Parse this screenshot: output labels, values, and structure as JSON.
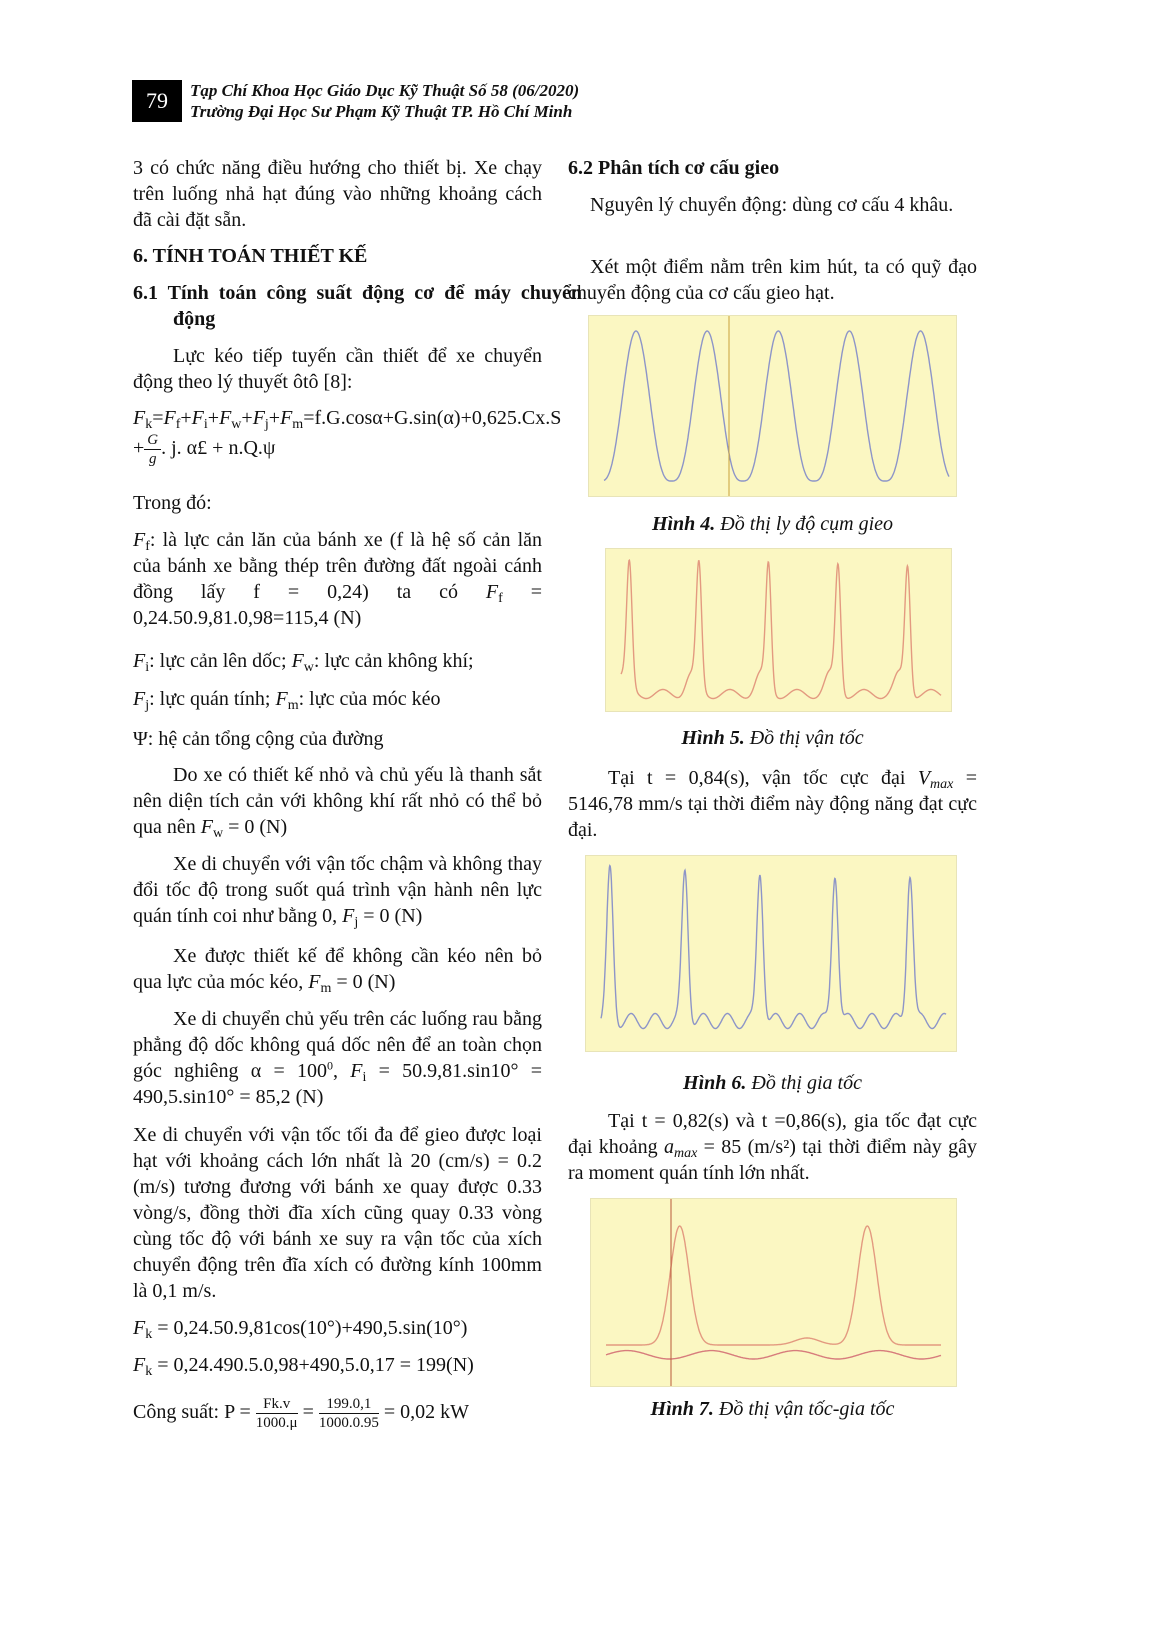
{
  "header": {
    "page_number": "79",
    "journal": "Tạp Chí Khoa Học Giáo Dục Kỹ Thuật Số 58 (06/2020)",
    "university": "Trường Đại Học Sư Phạm Kỹ Thuật TP. Hồ Chí Minh"
  },
  "left": {
    "p1": "3 có chức năng điều hướng cho thiết bị. Xe chạy trên luống nhả hạt đúng vào những khoảng cách đã cài đặt sẵn.",
    "h6": "6.   TÍNH TOÁN THIẾT KẾ",
    "h61": "6.1 Tính toán công suất động cơ để máy chuyển động",
    "p2": "Lực kéo tiếp tuyến cần thiết để xe chuyển động theo lý thuyết ôtô [8]:",
    "eq1_rhs": "=f.G.cosα+G.sin(α)+0,625.Cx.S +",
    "eq1_tail": ". j. α£  + n.Q.ψ",
    "trong_do": "Trong đó:",
    "ff_text": ": là lực cản lăn của bánh xe (f là hệ số cản lăn của bánh xe bằng thép trên đường đất ngoài cánh đồng lấy f = 0,24) ta có",
    "ff_value": "= 0,24.50.9,81.0,98=115,4 (N)",
    "fi_text": ": lực cản lên dốc;",
    "fw_text": ": lực cản không khí;",
    "fj_text": ": lực quán tính;",
    "fm_text": ": lực của móc kéo",
    "psi": "Ψ: hệ cản tổng cộng của đường",
    "p_fw": "Do xe có thiết kế nhỏ và chủ yếu là thanh sắt nên diện tích cản với không khí rất nhỏ có thể bỏ qua nên",
    "p_fw_val": "= 0 (N)",
    "p_fj": "Xe di chuyển với vận tốc chậm và không thay đổi tốc độ trong suốt quá trình vận hành nên lực quán tính coi như bằng 0,",
    "p_fj_val": "= 0 (N)",
    "p_fm": "Xe được thiết kế để không cần kéo nên bỏ qua lực của móc kéo,",
    "p_fm_val": "= 0 (N)",
    "p_fi": "Xe di chuyển chủ yếu trên các luống rau bằng phẳng độ dốc không quá dốc nên để an toàn chọn góc nghiêng α = 100",
    "p_fi_val": "= 50.9,81.sin10° = 490,5.sin10° = 85,2 (N)",
    "p_speed": "Xe di chuyển với vận tốc tối đa để gieo được loại hạt với khoảng cách lớn nhất là 20 (cm/s) = 0.2 (m/s) tương đương với bánh xe quay được 0.33 vòng/s, đồng thời đĩa xích cũng quay 0.33 vòng cùng tốc độ với bánh xe suy ra vận tốc của xích chuyển động trên đĩa xích có đường kính 100mm là 0,1 m/s.",
    "fk1": "= 0,24.50.9,81cos(10°)+490,5.sin(10°)",
    "fk2": "= 0,24.490.5.0,98+490,5.0,17 = 199(N)",
    "power_label": "Công suất: P =",
    "power_num1": "Fk.v",
    "power_den1": "1000.μ",
    "power_num2": "199.0,1",
    "power_den2": "1000.0.95",
    "power_result": "= 0,02 kW"
  },
  "right": {
    "h62": "6.2  Phân tích cơ cấu gieo",
    "p1": "Nguyên lý chuyển động: dùng cơ cấu 4 khâu.",
    "p2": "Xét một điểm nằm trên kim hút, ta có quỹ đạo chuyển động của cơ cấu gieo hạt.",
    "fig4_label": "Hình 4.",
    "fig4_title": "Đồ thị ly độ cụm gieo",
    "fig5_label": "Hình 5.",
    "fig5_title": "Đồ thị vận tốc",
    "p3a": "Tại t = 0,84(s), vận tốc cực đại",
    "p3b": "= 5146,78 mm/s tại thời điểm này động năng đạt cực đại.",
    "fig6_label": "Hình 6.",
    "fig6_title": "Đồ thị gia tốc",
    "p4a": "Tại t = 0,82(s) và t =0,86(s), gia tốc đạt cực đại khoảng",
    "p4b": "= 85 (m/s²) tại thời điểm này gây ra moment quán tính lớn nhất.",
    "fig7_label": "Hình 7.",
    "fig7_title": "Đồ thị vận tốc-gia tốc"
  },
  "colors": {
    "plot_bg": "#fbf7c2",
    "blue_curve": "#8d95c8",
    "orange_curve": "#e39a80",
    "marker": "#c9a13a"
  }
}
